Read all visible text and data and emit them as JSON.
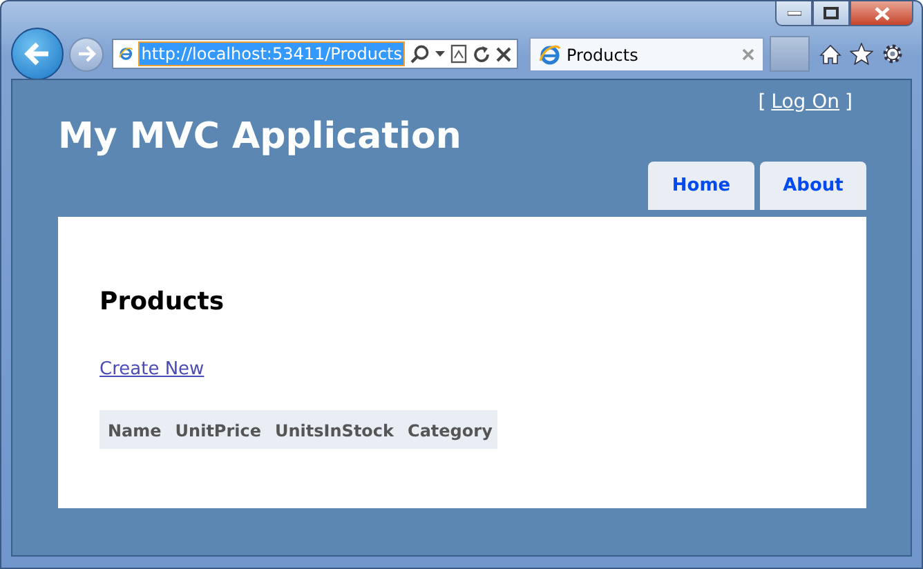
{
  "browser": {
    "address": {
      "url": "http://localhost:53411/Products",
      "selected": true
    },
    "tabs": [
      {
        "title": "Products",
        "selected": true
      }
    ]
  },
  "page": {
    "login": {
      "open": "[",
      "link": "Log On",
      "close": "]"
    },
    "title": "My MVC Application",
    "menu": [
      {
        "label": "Home"
      },
      {
        "label": "About"
      }
    ],
    "heading": "Products",
    "create_link": "Create New",
    "table": {
      "columns": [
        "Name",
        "UnitPrice",
        "UnitsInStock",
        "Category"
      ]
    }
  }
}
